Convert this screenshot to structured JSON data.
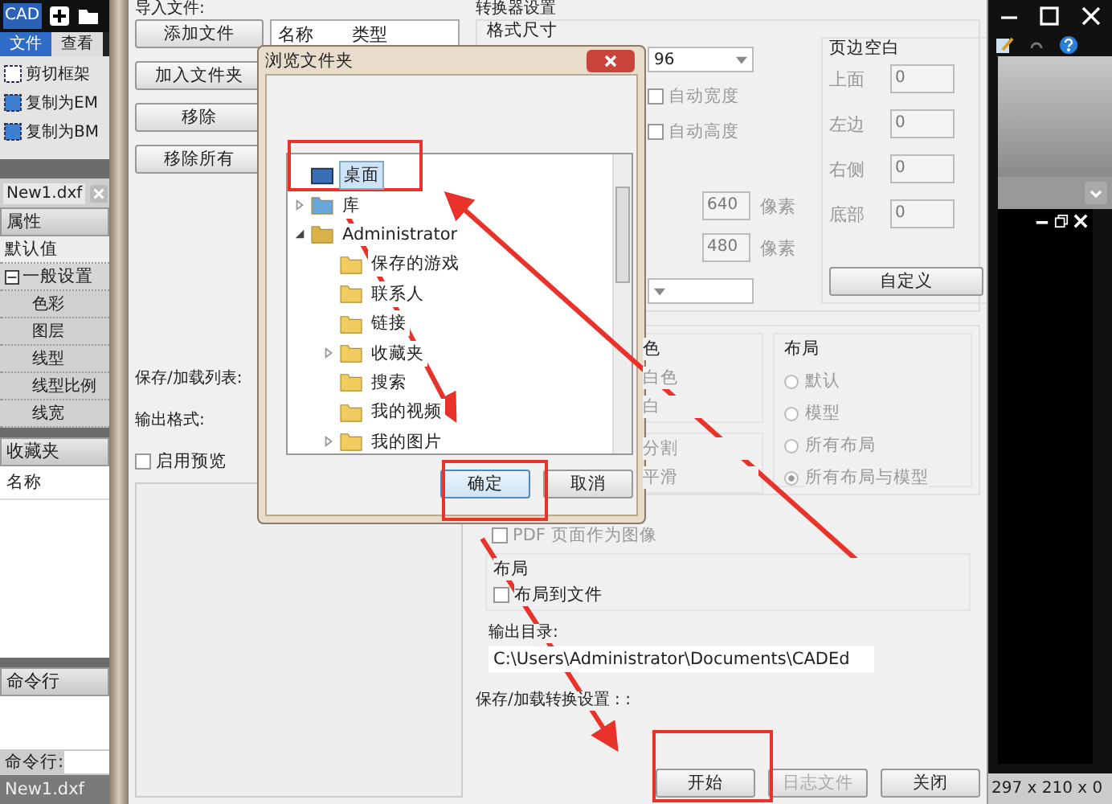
{
  "sidebar": {
    "logo": "CAD",
    "tabs": [
      {
        "label": "文件",
        "selected": true
      },
      {
        "label": "查看",
        "selected": false
      }
    ],
    "commands": [
      "剪切框架",
      "复制为EM",
      "复制为BM"
    ],
    "document_tab": "New1.dxf",
    "properties": {
      "title": "属性",
      "default_row": "默认值",
      "group": {
        "label": "一般设置",
        "expanded": true,
        "children": [
          "色彩",
          "图层",
          "线型",
          "线型比例",
          "线宽"
        ]
      }
    },
    "favorites": {
      "title": "收藏夹",
      "column": "名称"
    },
    "command_line": {
      "title": "命令行",
      "label": "命令行:"
    },
    "status": "New1.dxf"
  },
  "converter": {
    "import_label": "导入文件:",
    "file_buttons": [
      "添加文件",
      "加入文件夹",
      "移除",
      "移除所有"
    ],
    "file_columns": [
      "名称",
      "类型"
    ],
    "save_load_list_label": "保存/加载列表:",
    "output_format_label": "输出格式:",
    "preview": {
      "label": "启用预览",
      "checked": false
    },
    "settings_title": "转换器设置",
    "format_size": {
      "title": "格式尺寸",
      "dpi": "96",
      "auto_width": {
        "label": "自动宽度",
        "checked": false
      },
      "auto_height": {
        "label": "自动高度",
        "checked": false
      },
      "width": {
        "value": "640",
        "unit": "像素"
      },
      "height": {
        "value": "480",
        "unit": "像素"
      }
    },
    "margins": {
      "title": "页边空白",
      "fields": [
        {
          "label": "上面",
          "value": "0"
        },
        {
          "label": "左边",
          "value": "0"
        },
        {
          "label": "右侧",
          "value": "0"
        },
        {
          "label": "底部",
          "value": "0"
        }
      ],
      "custom_button": "自定义"
    },
    "color": {
      "title": "色",
      "options": [
        "白色",
        "白"
      ]
    },
    "arc": {
      "options": [
        "分割",
        "平滑"
      ]
    },
    "layout": {
      "title": "布局",
      "options": [
        {
          "label": "默认",
          "selected": false
        },
        {
          "label": "模型",
          "selected": false
        },
        {
          "label": "所有布局",
          "selected": false
        },
        {
          "label": "所有布局与模型",
          "selected": true
        }
      ]
    },
    "pdf_as_image": {
      "label": "PDF 页面作为图像",
      "checked": false
    },
    "layout_file": {
      "title": "布局",
      "checkbox": {
        "label": "布局到文件",
        "checked": false
      }
    },
    "output_dir": {
      "label": "输出目录:",
      "value": "C:\\Users\\Administrator\\Documents\\CADEd"
    },
    "save_settings_label": "保存/加载转换设置 : :",
    "actions": [
      {
        "label": "开始",
        "disabled": false
      },
      {
        "label": "日志文件",
        "disabled": true
      },
      {
        "label": "关闭",
        "disabled": false
      }
    ]
  },
  "right_panel": {
    "status": "297 x 210 x 0"
  },
  "dialog": {
    "title": "浏览文件夹",
    "tree": [
      {
        "label": "桌面",
        "kind": "desktop",
        "selected": true
      },
      {
        "label": "库",
        "kind": "library",
        "expanded": false,
        "selected": false
      },
      {
        "label": "Administrator",
        "kind": "user",
        "expanded": true,
        "selected": false,
        "children": [
          {
            "label": "保存的游戏",
            "kind": "folder",
            "selected": false
          },
          {
            "label": "联系人",
            "kind": "folder",
            "selected": false
          },
          {
            "label": "链接",
            "kind": "folder",
            "selected": false
          },
          {
            "label": "收藏夹",
            "kind": "folder",
            "expanded": false,
            "selected": false
          },
          {
            "label": "搜索",
            "kind": "folder",
            "selected": false
          },
          {
            "label": "我的视频",
            "kind": "folder",
            "selected": false
          },
          {
            "label": "我的图片",
            "kind": "folder",
            "expanded": false,
            "selected": false
          }
        ]
      }
    ],
    "buttons": [
      {
        "label": "确定",
        "default": true
      },
      {
        "label": "取消",
        "default": false
      }
    ]
  }
}
